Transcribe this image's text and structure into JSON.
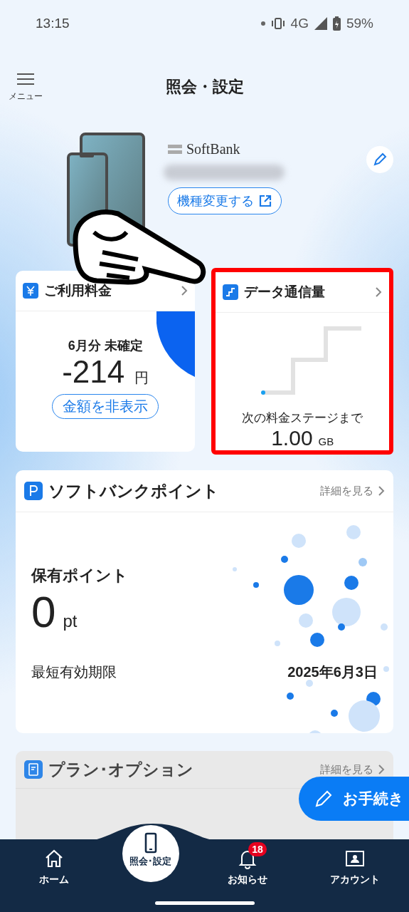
{
  "status_bar": {
    "time": "13:15",
    "network": "4G",
    "battery": "59%"
  },
  "header": {
    "menu_label": "メニュー",
    "title": "照会・設定"
  },
  "device": {
    "carrier": "SoftBank",
    "change_button": "機種変更する"
  },
  "billing_card": {
    "title": "ご利用料金",
    "period": "6月分 未確定",
    "amount": "-214",
    "unit": "円",
    "hide_button": "金額を非表示"
  },
  "data_card": {
    "title": "データ通信量",
    "caption": "次の料金ステージまで",
    "amount": "1.00",
    "unit": "GB",
    "highlighted": true
  },
  "points_card": {
    "title": "ソフトバンクポイント",
    "detail_link": "詳細を見る",
    "label": "保有ポイント",
    "value": "0",
    "unit": "pt",
    "expiry_label": "最短有効期限",
    "expiry_date": "2025年6月3日"
  },
  "plan_card": {
    "title": "プラン･オプション",
    "detail_link": "詳細を見る"
  },
  "fab": {
    "label": "お手続き"
  },
  "nav": [
    {
      "kind": "home",
      "label": "ホーム",
      "selected": false
    },
    {
      "kind": "device",
      "label": "照会･設定",
      "selected": true
    },
    {
      "kind": "bell",
      "label": "お知らせ",
      "selected": false,
      "badge": "18"
    },
    {
      "kind": "account",
      "label": "アカウント",
      "selected": false
    }
  ]
}
